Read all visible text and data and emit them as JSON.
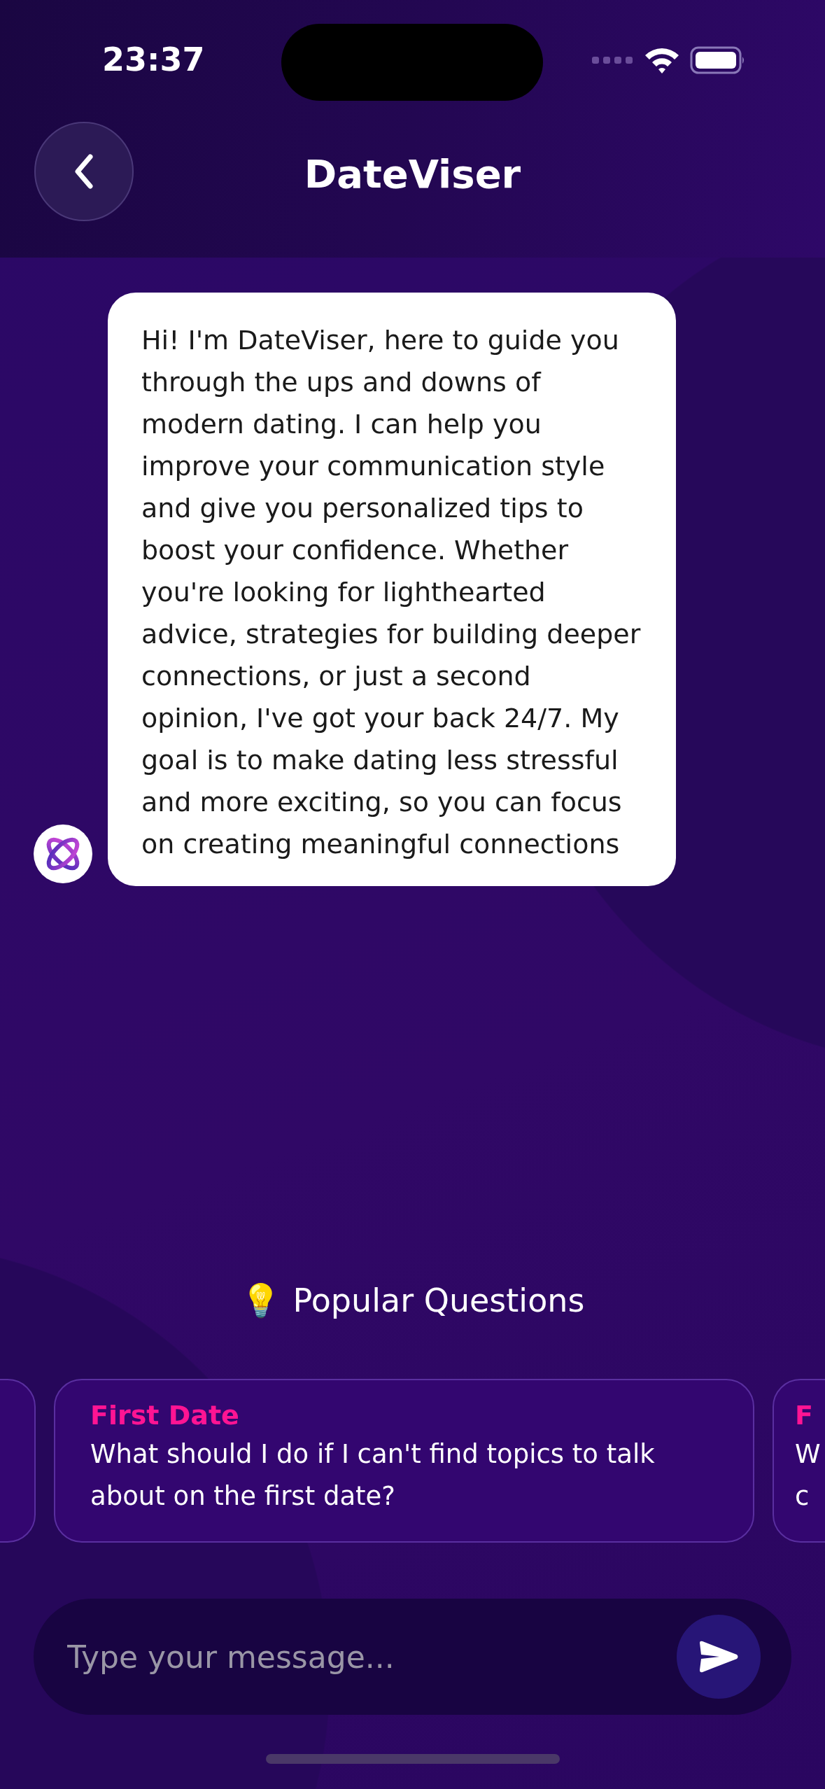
{
  "status_bar": {
    "time": "23:37"
  },
  "header": {
    "title": "DateViser"
  },
  "messages": [
    {
      "kind": "bot",
      "text": "Hi! I'm DateViser, here to guide you through the ups and downs of modern dating. I can help you improve your communication style and give you personalized tips to boost your confidence. Whether you're looking for lighthearted advice, strategies for building deeper connections, or just a second opinion, I've got your back 24/7. My goal is to make dating less stressful and more exciting, so you can focus on creating meaningful connections"
    }
  ],
  "popular": {
    "icon": "💡",
    "title": "Popular Questions"
  },
  "questions": [
    {
      "kind": "edge"
    },
    {
      "kind": "full",
      "category": "First Date",
      "question": "What should I do if I can't find topics to talk about on the first date?"
    },
    {
      "kind": "cut",
      "category": "F",
      "lines": [
        "W",
        "c"
      ]
    }
  ],
  "composer": {
    "placeholder": "Type your message..."
  }
}
